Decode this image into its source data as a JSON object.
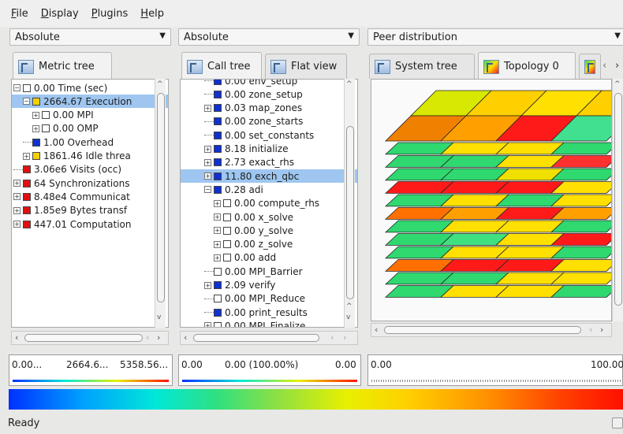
{
  "menu": [
    {
      "first": "F",
      "rest": "ile"
    },
    {
      "first": "D",
      "rest": "isplay"
    },
    {
      "first": "P",
      "rest": "lugins"
    },
    {
      "first": "H",
      "rest": "elp"
    }
  ],
  "combos": [
    "Absolute",
    "Absolute",
    "Peer distribution"
  ],
  "tabs": {
    "metric_tree": "Metric tree",
    "call_tree": "Call tree",
    "flat_view": "Flat view",
    "system_tree": "System tree",
    "topology": "Topology 0"
  },
  "metric_tree": [
    {
      "exp": "−",
      "sq": "white",
      "label": "0.00 Time (sec)",
      "lvl": 0,
      "sel": false
    },
    {
      "exp": "−",
      "sq": "yellow",
      "label": "2664.67 Execution",
      "lvl": 1,
      "sel": true
    },
    {
      "exp": "+",
      "sq": "white",
      "label": "0.00 MPI",
      "lvl": 2,
      "sel": false
    },
    {
      "exp": "+",
      "sq": "white",
      "label": "0.00 OMP",
      "lvl": 2,
      "sel": false
    },
    {
      "exp": "",
      "sq": "blue",
      "label": "1.00 Overhead",
      "lvl": 1,
      "sel": false
    },
    {
      "exp": "+",
      "sq": "yellow",
      "label": "1861.46 Idle threa",
      "lvl": 1,
      "sel": false
    },
    {
      "exp": "",
      "sq": "red",
      "label": "3.06e6 Visits (occ)",
      "lvl": 0,
      "sel": false
    },
    {
      "exp": "+",
      "sq": "red",
      "label": "64 Synchronizations",
      "lvl": 0,
      "sel": false
    },
    {
      "exp": "+",
      "sq": "red",
      "label": "8.48e4 Communicat",
      "lvl": 0,
      "sel": false
    },
    {
      "exp": "+",
      "sq": "red",
      "label": "1.85e9 Bytes transf",
      "lvl": 0,
      "sel": false
    },
    {
      "exp": "+",
      "sq": "red",
      "label": "447.01 Computation",
      "lvl": 0,
      "sel": false
    }
  ],
  "call_tree": [
    {
      "exp": "",
      "sq": "blue",
      "label": "0.00 env_setup",
      "lvl": 1,
      "sel": false
    },
    {
      "exp": "",
      "sq": "blue",
      "label": "0.00 zone_setup",
      "lvl": 1,
      "sel": false
    },
    {
      "exp": "+",
      "sq": "blue",
      "label": "0.03 map_zones",
      "lvl": 1,
      "sel": false
    },
    {
      "exp": "",
      "sq": "blue",
      "label": "0.00 zone_starts",
      "lvl": 1,
      "sel": false
    },
    {
      "exp": "",
      "sq": "blue",
      "label": "0.00 set_constants",
      "lvl": 1,
      "sel": false
    },
    {
      "exp": "+",
      "sq": "blue",
      "label": "8.18 initialize",
      "lvl": 1,
      "sel": false
    },
    {
      "exp": "+",
      "sq": "blue",
      "label": "2.73 exact_rhs",
      "lvl": 1,
      "sel": false
    },
    {
      "exp": "+",
      "sq": "blue",
      "label": "11.80 exch_qbc",
      "lvl": 1,
      "sel": true
    },
    {
      "exp": "−",
      "sq": "blue",
      "label": "0.28 adi",
      "lvl": 1,
      "sel": false
    },
    {
      "exp": "+",
      "sq": "white",
      "label": "0.00 compute_rhs",
      "lvl": 2,
      "sel": false
    },
    {
      "exp": "+",
      "sq": "white",
      "label": "0.00 x_solve",
      "lvl": 2,
      "sel": false
    },
    {
      "exp": "+",
      "sq": "white",
      "label": "0.00 y_solve",
      "lvl": 2,
      "sel": false
    },
    {
      "exp": "+",
      "sq": "white",
      "label": "0.00 z_solve",
      "lvl": 2,
      "sel": false
    },
    {
      "exp": "+",
      "sq": "white",
      "label": "0.00 add",
      "lvl": 2,
      "sel": false
    },
    {
      "exp": "",
      "sq": "white",
      "label": "0.00 MPI_Barrier",
      "lvl": 1,
      "sel": false
    },
    {
      "exp": "+",
      "sq": "blue",
      "label": "2.09 verify",
      "lvl": 1,
      "sel": false
    },
    {
      "exp": "",
      "sq": "white",
      "label": "0.00 MPI_Reduce",
      "lvl": 1,
      "sel": false
    },
    {
      "exp": "",
      "sq": "blue",
      "label": "0.00 print_results",
      "lvl": 1,
      "sel": false
    },
    {
      "exp": "+",
      "sq": "white",
      "label": "0.00 MPI_Finalize",
      "lvl": 1,
      "sel": false
    }
  ],
  "scales": {
    "metric": [
      "0.00...",
      "2664.6...",
      "5358.56..."
    ],
    "call": [
      "0.00",
      "0.00 (100.00%)",
      "0.00"
    ],
    "system": [
      "0.00",
      "100.00"
    ]
  },
  "topology": {
    "top_colors": [
      "#d8e800",
      "#ffd000",
      "#ffe000",
      "#f08000",
      "#ffa000",
      "#ff1a1a",
      "#40e090"
    ],
    "layers": [
      [
        "#30d870",
        "#ffe000",
        "#ffe000",
        "#30d870"
      ],
      [
        "#30d870",
        "#30d870",
        "#ffe000",
        "#ff3030"
      ],
      [
        "#30d870",
        "#30d870",
        "#f0e000",
        "#30d870"
      ],
      [
        "#ff1a1a",
        "#ff1a1a",
        "#ff1a1a",
        "#ffe000"
      ],
      [
        "#30d870",
        "#ffe000",
        "#30d870",
        "#ffe000"
      ],
      [
        "#ff7000",
        "#ffa000",
        "#ff1a1a",
        "#ffa000"
      ],
      [
        "#30d870",
        "#ffe000",
        "#ffe000",
        "#30d870"
      ],
      [
        "#30d870",
        "#40e080",
        "#ffe000",
        "#ff1a1a"
      ],
      [
        "#30d870",
        "#ffe000",
        "#ffe000",
        "#30d870"
      ],
      [
        "#ff7000",
        "#ff1a1a",
        "#ff1a1a",
        "#ffe000"
      ],
      [
        "#30d870",
        "#30d870",
        "#ffe000",
        "#ffe000"
      ],
      [
        "#30d870",
        "#ffe000",
        "#ffe000",
        "#30d870"
      ]
    ]
  },
  "status": "Ready"
}
